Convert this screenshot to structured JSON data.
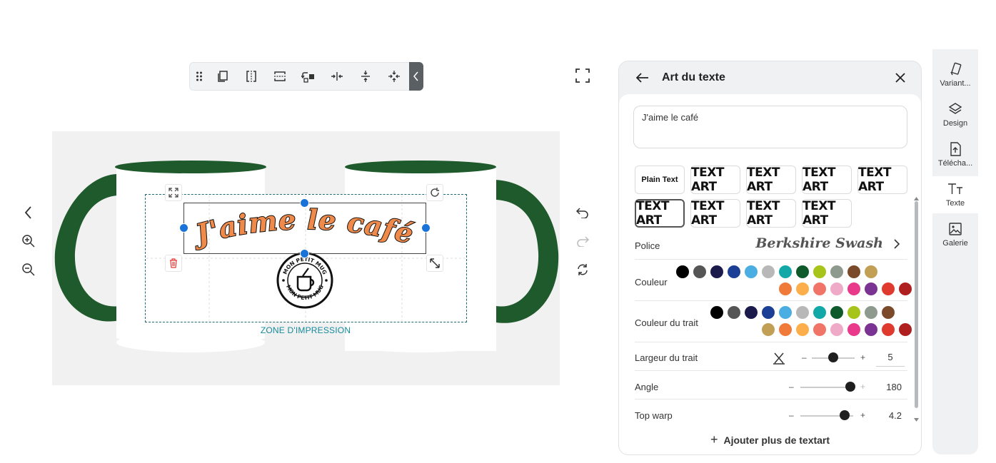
{
  "toolbar": {
    "tools": [
      "drag-handle",
      "duplicate",
      "flip-horizontal",
      "flip-vertical",
      "replace",
      "center-horizontal",
      "center-vertical",
      "center-both"
    ]
  },
  "canvas": {
    "design_text": "J'aime le café",
    "logo_text_top": "MON PETIT MUG",
    "logo_text_bottom": "MON PETIT MUG",
    "zone_label": "ZONE D'IMPRESSION",
    "mug_color": "#1f5a2c",
    "text_fill": "#f08a4b"
  },
  "panel": {
    "title": "Art du texte",
    "text_value": "J'aime le café",
    "styles": [
      "Plain Text",
      "TEXT ART",
      "TEXT ART",
      "TEXT ART",
      "TEXT ART",
      "TEXT ART",
      "TEXT ART",
      "TEXT ART",
      "TEXT ART"
    ],
    "font_label": "Police",
    "font_value": "Berkshire Swash",
    "color_label": "Couleur",
    "colors": [
      "#000000",
      "#555555",
      "#1c1a4a",
      "#1b3f94",
      "#4aaee3",
      "#b8b8b8",
      "#13a8a8",
      "#0e5a2b",
      "#a6c41a",
      "#8e9a8e",
      "#7a4a2a",
      "#c1a055",
      "#f07a3a",
      "#fbae4a",
      "#f07467",
      "#eeaac6",
      "#e8398a",
      "#7a3393",
      "#e03a2e",
      "#b01f1f"
    ],
    "stroke_color_label": "Couleur du trait",
    "stroke_colors": [
      "#000000",
      "#555555",
      "#1c1a4a",
      "#1b3f94",
      "#4aaee3",
      "#b8b8b8",
      "#13a8a8",
      "#0e5a2b",
      "#a6c41a",
      "#8e9a8e",
      "#7a4a2a",
      "#c1a055",
      "#f07a3a",
      "#fbae4a",
      "#f07467",
      "#eeaac6",
      "#e8398a",
      "#7a3393",
      "#e03a2e",
      "#b01f1f"
    ],
    "stroke_width_label": "Largeur du trait",
    "stroke_width_value": "5",
    "stroke_width_fraction": 0.5,
    "angle_label": "Angle",
    "angle_value": "180",
    "angle_fraction": 1.0,
    "top_warp_label": "Top warp",
    "top_warp_value": "4.2",
    "top_warp_fraction": 0.84,
    "minus": "–",
    "plus": "+",
    "add_button": "Ajouter plus de textart"
  },
  "right_nav": [
    {
      "label": "Variant...",
      "icon": "variant-icon"
    },
    {
      "label": "Design",
      "icon": "layers-icon"
    },
    {
      "label": "Télécha...",
      "icon": "upload-icon"
    },
    {
      "label": "Texte",
      "icon": "text-icon"
    },
    {
      "label": "Galerie",
      "icon": "image-icon"
    }
  ]
}
